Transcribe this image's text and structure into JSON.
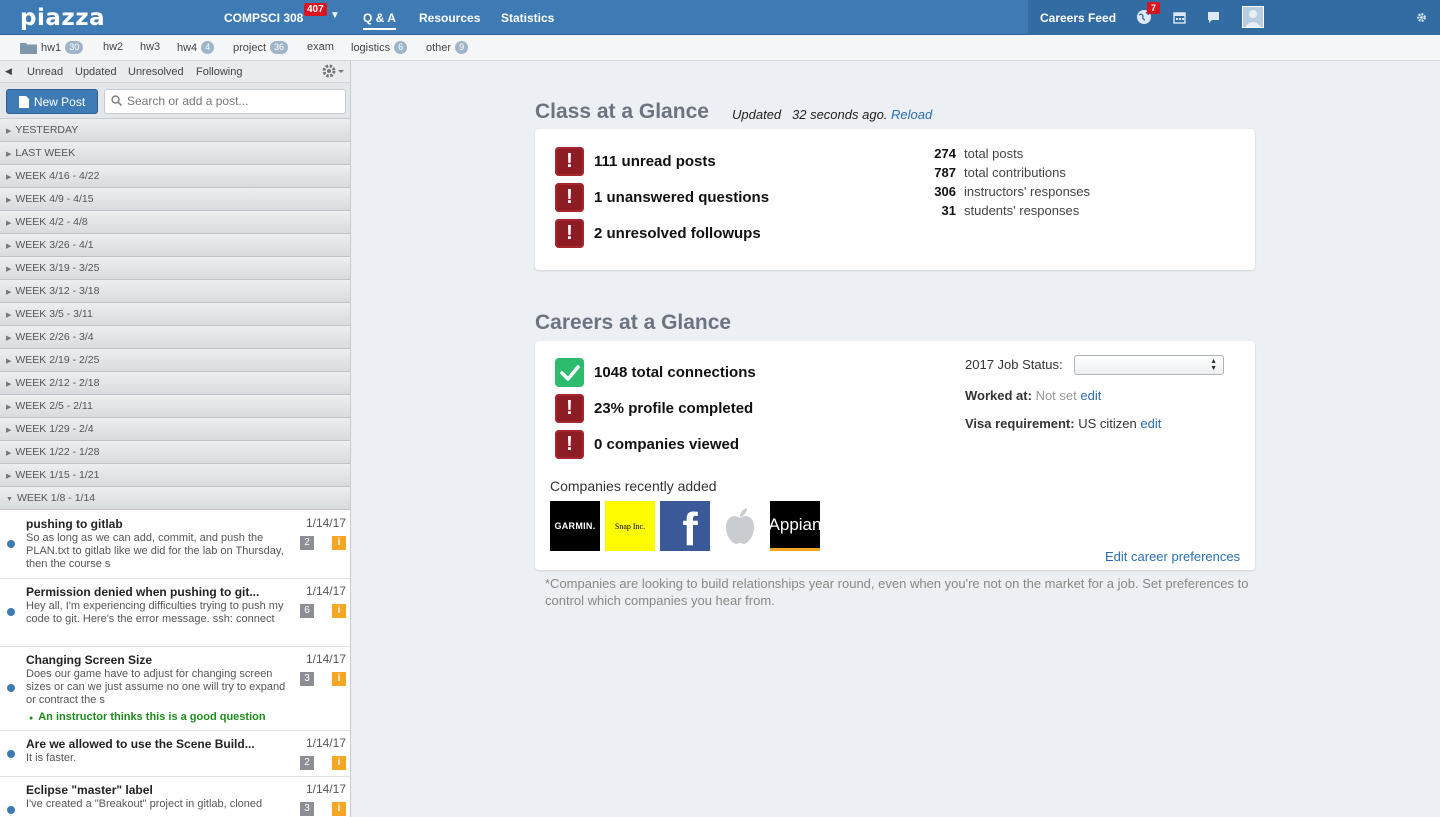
{
  "topbar": {
    "logo": "piazza",
    "course": "COMPSCI 308",
    "course_badge": "407",
    "nav": [
      "Q & A",
      "Resources",
      "Statistics"
    ],
    "careers_feed": "Careers Feed",
    "notif_count": "7"
  },
  "folders": [
    {
      "name": "hw1",
      "count": "30"
    },
    {
      "name": "hw2",
      "count": ""
    },
    {
      "name": "hw3",
      "count": ""
    },
    {
      "name": "hw4",
      "count": "4"
    },
    {
      "name": "project",
      "count": "36"
    },
    {
      "name": "exam",
      "count": ""
    },
    {
      "name": "logistics",
      "count": "6"
    },
    {
      "name": "other",
      "count": "9"
    }
  ],
  "sidebar": {
    "filters": [
      "Unread",
      "Updated",
      "Unresolved",
      "Following"
    ],
    "new_post": "New Post",
    "search_placeholder": "Search or add a post...",
    "weeks": [
      "YESTERDAY",
      "LAST WEEK",
      "WEEK 4/16 - 4/22",
      "WEEK 4/9 - 4/15",
      "WEEK 4/2 - 4/8",
      "WEEK 3/26 - 4/1",
      "WEEK 3/19 - 3/25",
      "WEEK 3/12 - 3/18",
      "WEEK 3/5 - 3/11",
      "WEEK 2/26 - 3/4",
      "WEEK 2/19 - 2/25",
      "WEEK 2/12 - 2/18",
      "WEEK 2/5 - 2/11",
      "WEEK 1/29 - 2/4",
      "WEEK 1/22 - 1/28",
      "WEEK 1/15 - 1/21",
      "WEEK 1/8 - 1/14"
    ],
    "posts": [
      {
        "title": "pushing to gitlab",
        "date": "1/14/17",
        "body": "So as long as we can add, commit, and push the PLAN.txt to gitlab like we did for the lab on Thursday, then the course s",
        "count": "2",
        "note": ""
      },
      {
        "title": "Permission denied when pushing to git...",
        "date": "1/14/17",
        "body": "Hey all,  I'm experiencing difficulties trying to push my code to git. Here's the error message. ssh: connect",
        "count": "6",
        "note": ""
      },
      {
        "title": "Changing Screen Size",
        "date": "1/14/17",
        "body": "Does our game have to adjust for changing screen sizes or can we just assume no one will try to expand or contract the s",
        "count": "3",
        "note": "An instructor thinks this is a good question"
      },
      {
        "title": "Are we allowed to use the Scene Build...",
        "date": "1/14/17",
        "body": "It is faster.",
        "count": "2",
        "note": ""
      },
      {
        "title": "Eclipse \"master\" label",
        "date": "1/14/17",
        "body": "I've created a \"Breakout\" project in gitlab, cloned",
        "count": "3",
        "note": ""
      }
    ]
  },
  "class_glance": {
    "title": "Class at a Glance",
    "updated_prefix": "Updated",
    "updated_time": "32 seconds ago.",
    "reload": "Reload",
    "alerts": [
      "111 unread posts",
      "1 unanswered questions",
      "2 unresolved followups"
    ],
    "stats": [
      {
        "n": "274",
        "label": "total posts"
      },
      {
        "n": "787",
        "label": "total contributions"
      },
      {
        "n": "306",
        "label": "instructors' responses"
      },
      {
        "n": "31",
        "label": "students' responses"
      }
    ]
  },
  "careers_glance": {
    "title": "Careers at a Glance",
    "items": [
      "1048 total connections",
      "23% profile completed",
      "0 companies viewed"
    ],
    "job_status_label": "2017 Job Status:",
    "worked_at_label": "Worked at:",
    "worked_at_value": "Not set",
    "edit": "edit",
    "visa_label": "Visa requirement:",
    "visa_value": "US citizen",
    "companies_label": "Companies recently added",
    "companies": [
      "GARMIN.",
      "Snap Inc.",
      "f",
      "",
      "Appian"
    ],
    "edit_prefs": "Edit career preferences",
    "footnote": "*Companies are looking to build relationships year round, even when you're not on the market for a job. Set preferences to control which companies you hear from."
  }
}
